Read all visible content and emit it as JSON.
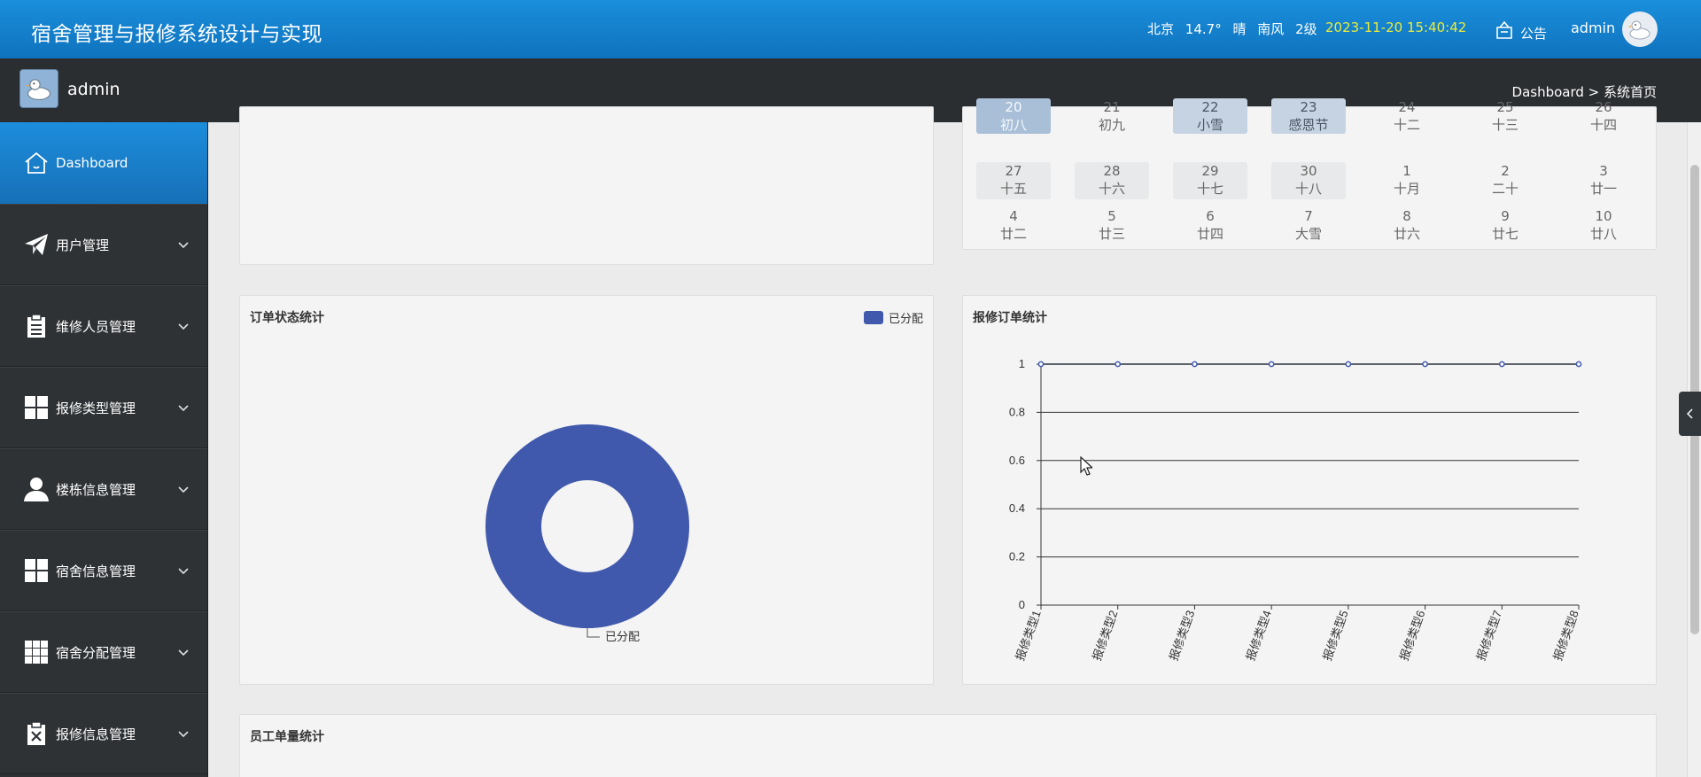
{
  "header": {
    "app_title": "宿舍管理与报修系统设计与实现",
    "weather": {
      "city": "北京",
      "temp": "14.7°",
      "condition": "晴",
      "wind": "南风",
      "level": "2级"
    },
    "datetime": "2023-11-20 15:40:42",
    "notice_label": "公告",
    "user": "admin",
    "clock_color": "#e9ec3c"
  },
  "subbar": {
    "user": "admin",
    "breadcrumb": "Dashboard > 系统首页"
  },
  "sidebar": {
    "items": [
      {
        "label": "Dashboard",
        "icon": "home-icon",
        "active": true
      },
      {
        "label": "用户管理",
        "icon": "paper-plane-icon"
      },
      {
        "label": "维修人员管理",
        "icon": "clipboard-icon"
      },
      {
        "label": "报修类型管理",
        "icon": "grid-icon"
      },
      {
        "label": "楼栋信息管理",
        "icon": "person-icon"
      },
      {
        "label": "宿舍信息管理",
        "icon": "grid-icon"
      },
      {
        "label": "宿舍分配管理",
        "icon": "grid-9-icon"
      },
      {
        "label": "报修信息管理",
        "icon": "clipboard-x-icon"
      }
    ]
  },
  "calendar": {
    "rows": [
      [
        {
          "n": "20",
          "l": "初八",
          "style": "today"
        },
        {
          "n": "21",
          "l": "初九"
        },
        {
          "n": "22",
          "l": "小雪",
          "style": "blue"
        },
        {
          "n": "23",
          "l": "感恩节",
          "style": "blue"
        },
        {
          "n": "24",
          "l": "十二"
        },
        {
          "n": "25",
          "l": "十三"
        },
        {
          "n": "26",
          "l": "十四"
        }
      ],
      [
        {
          "n": "27",
          "l": "十五",
          "style": "light"
        },
        {
          "n": "28",
          "l": "十六",
          "style": "light"
        },
        {
          "n": "29",
          "l": "十七",
          "style": "light"
        },
        {
          "n": "30",
          "l": "十八",
          "style": "light"
        },
        {
          "n": "1",
          "l": "十月"
        },
        {
          "n": "2",
          "l": "二十"
        },
        {
          "n": "3",
          "l": "廿一"
        }
      ],
      [
        {
          "n": "4",
          "l": "廿二"
        },
        {
          "n": "5",
          "l": "廿三"
        },
        {
          "n": "6",
          "l": "廿四"
        },
        {
          "n": "7",
          "l": "大雪"
        },
        {
          "n": "8",
          "l": "廿六"
        },
        {
          "n": "9",
          "l": "廿七"
        },
        {
          "n": "10",
          "l": "廿八"
        }
      ]
    ]
  },
  "panels": {
    "order_status_title": "订单状态统计",
    "repair_stats_title": "报修订单统计",
    "staff_stats_title": "员工单量统计"
  },
  "chart_data": [
    {
      "type": "pie",
      "title": "订单状态统计",
      "legend": [
        "已分配"
      ],
      "legend_position": "top-right",
      "slices": [
        {
          "label": "已分配",
          "value": 1,
          "color": "#4159ad"
        }
      ]
    },
    {
      "type": "line",
      "title": "报修订单统计",
      "categories": [
        "报修类型1",
        "报修类型2",
        "报修类型3",
        "报修类型4",
        "报修类型5",
        "报修类型6",
        "报修类型7",
        "报修类型8"
      ],
      "series": [
        {
          "values": [
            1,
            1,
            1,
            1,
            1,
            1,
            1,
            1
          ],
          "color": "#2a2f3a"
        }
      ],
      "yticks": [
        "0",
        "0.2",
        "0.4",
        "0.6",
        "0.8",
        "1"
      ],
      "ylim": [
        0,
        1
      ],
      "grid": true
    }
  ]
}
